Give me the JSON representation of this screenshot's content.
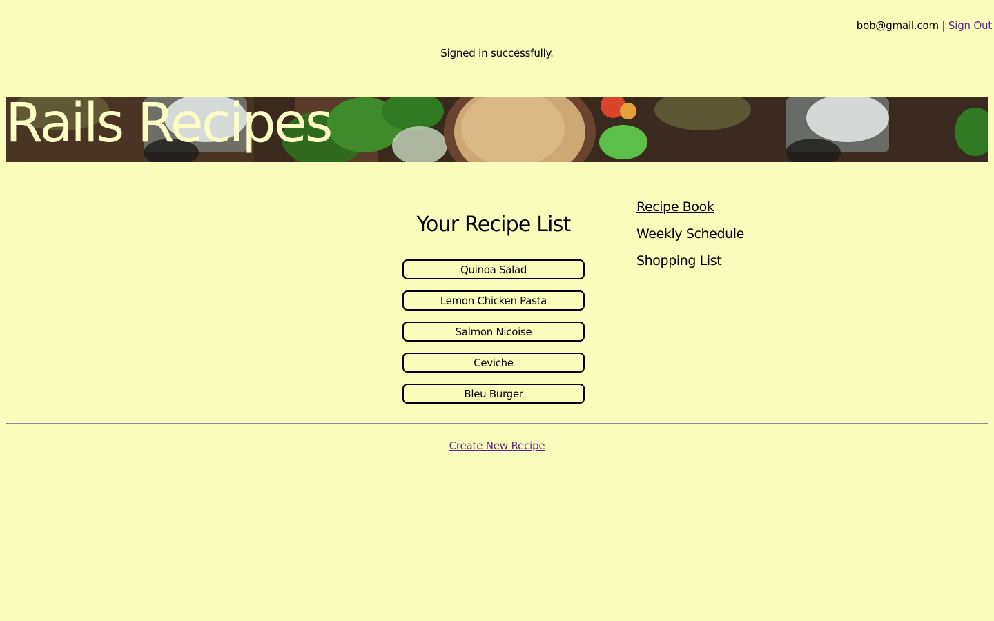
{
  "header": {
    "user_email": "bob@gmail.com",
    "separator": "|",
    "sign_out_label": "Sign Out"
  },
  "flash": {
    "message": "Signed in successfully."
  },
  "banner": {
    "title": "Rails Recipes"
  },
  "main": {
    "list_title": "Your Recipe List",
    "recipes": [
      {
        "label": "Quinoa Salad"
      },
      {
        "label": "Lemon Chicken Pasta"
      },
      {
        "label": "Salmon Nicoise"
      },
      {
        "label": "Ceviche"
      },
      {
        "label": "Bleu Burger"
      }
    ]
  },
  "side_nav": {
    "items": [
      {
        "label": "Recipe Book"
      },
      {
        "label": "Weekly Schedule"
      },
      {
        "label": "Shopping List"
      }
    ]
  },
  "footer": {
    "create_label": "Create New Recipe"
  },
  "colors": {
    "background": "#fafcbc",
    "link_visited": "#5b2a86",
    "banner_text": "#fbfdc4"
  }
}
